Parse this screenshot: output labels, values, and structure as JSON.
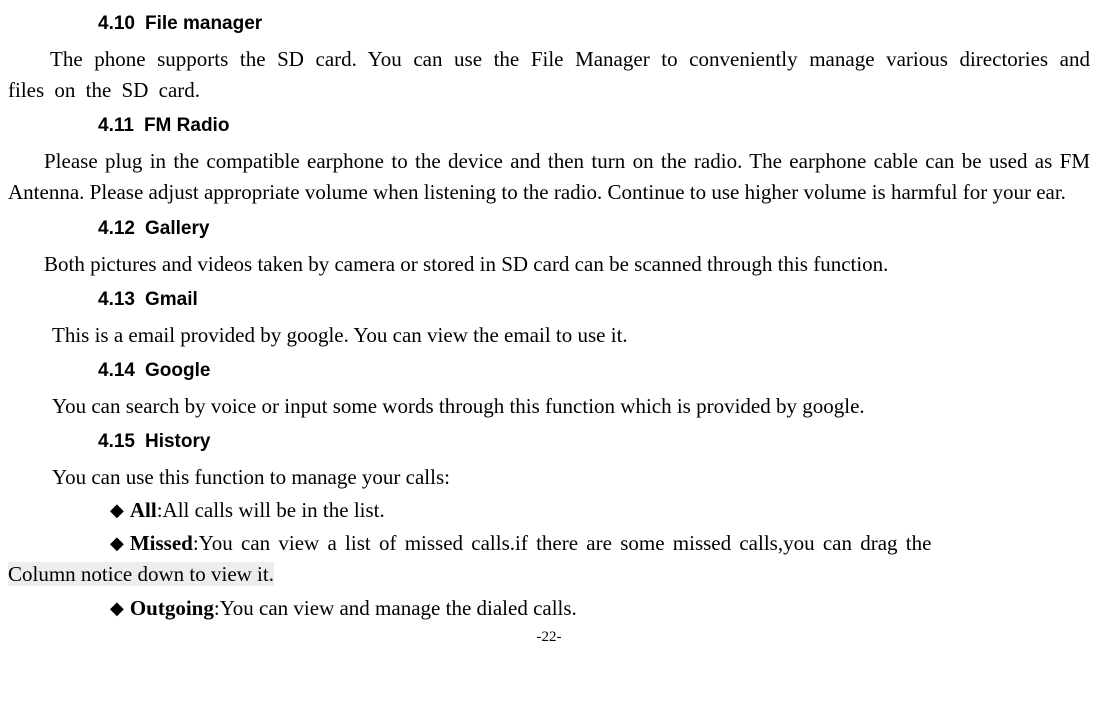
{
  "sections": {
    "s410": {
      "num": "4.10",
      "title": "File manager",
      "body": "The phone supports the SD card. You can use the File Manager to conveniently manage various directories and files on the SD card."
    },
    "s411": {
      "num": "4.11",
      "title": "FM Radio",
      "body": "Please plug in the compatible earphone to the device and then turn on the radio. The earphone cable can be used as FM Antenna. Please adjust appropriate volume when listening to the radio. Continue to use higher volume is harmful for your ear."
    },
    "s412": {
      "num": "4.12",
      "title": "Gallery",
      "body": "Both pictures and videos taken by camera or stored in SD card can be scanned through this function."
    },
    "s413": {
      "num": "4.13",
      "title": "Gmail",
      "body": "This is a email provided by google. You can view the email to use it."
    },
    "s414": {
      "num": "4.14",
      "title": "Google",
      "body": "You can search by voice or input some words through this function which is provided by google."
    },
    "s415": {
      "num": "4.15",
      "title": "History",
      "body": "You can use this function to manage your calls:"
    }
  },
  "history_items": {
    "all": {
      "label": "All",
      "text": ":All calls will be in the list."
    },
    "missed": {
      "label": "Missed",
      "text_part1": ":You can view a list of missed calls.if there are some missed calls,you can drag the",
      "text_part2": "Column notice down to view it."
    },
    "outgoing": {
      "label": "Outgoing",
      "text": ":You can view and manage the dialed calls."
    }
  },
  "bullet": "◆",
  "page_number": "-22-"
}
